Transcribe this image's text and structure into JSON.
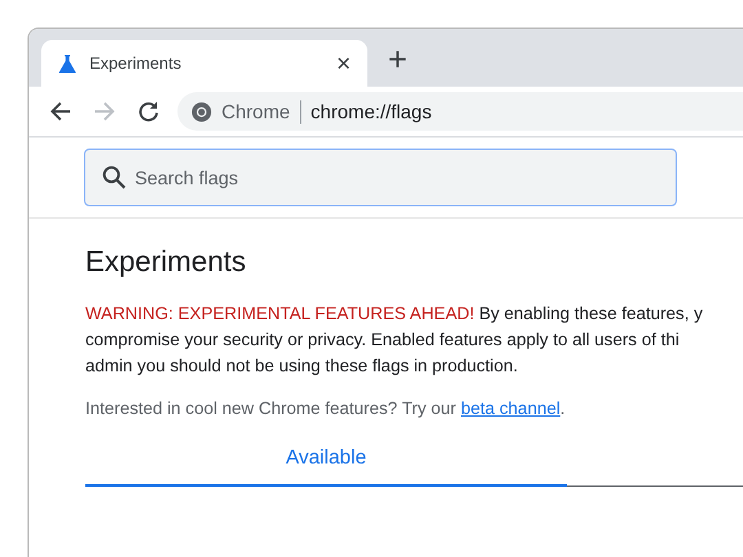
{
  "tabs": [
    {
      "title": "Experiments",
      "selected": true,
      "close": "×"
    }
  ],
  "new_tab": "+",
  "toolbar": {
    "back_enabled": true,
    "forward_enabled": false,
    "site": "Chrome",
    "url": "chrome://flags"
  },
  "search": {
    "placeholder": "Search flags"
  },
  "page": {
    "title": "Experiments",
    "warning": {
      "label": "WARNING: EXPERIMENTAL FEATURES AHEAD!",
      "lines": [
        "By enabling these features, y",
        "compromise your security or privacy. Enabled features apply to all users of thi",
        "admin you should not be using these flags in production."
      ]
    },
    "interest": {
      "text": "Interested in cool new Chrome features? Try our ",
      "link": "beta channel",
      "end": "."
    },
    "content_tabs": [
      {
        "label": "Available",
        "selected": true
      }
    ]
  }
}
